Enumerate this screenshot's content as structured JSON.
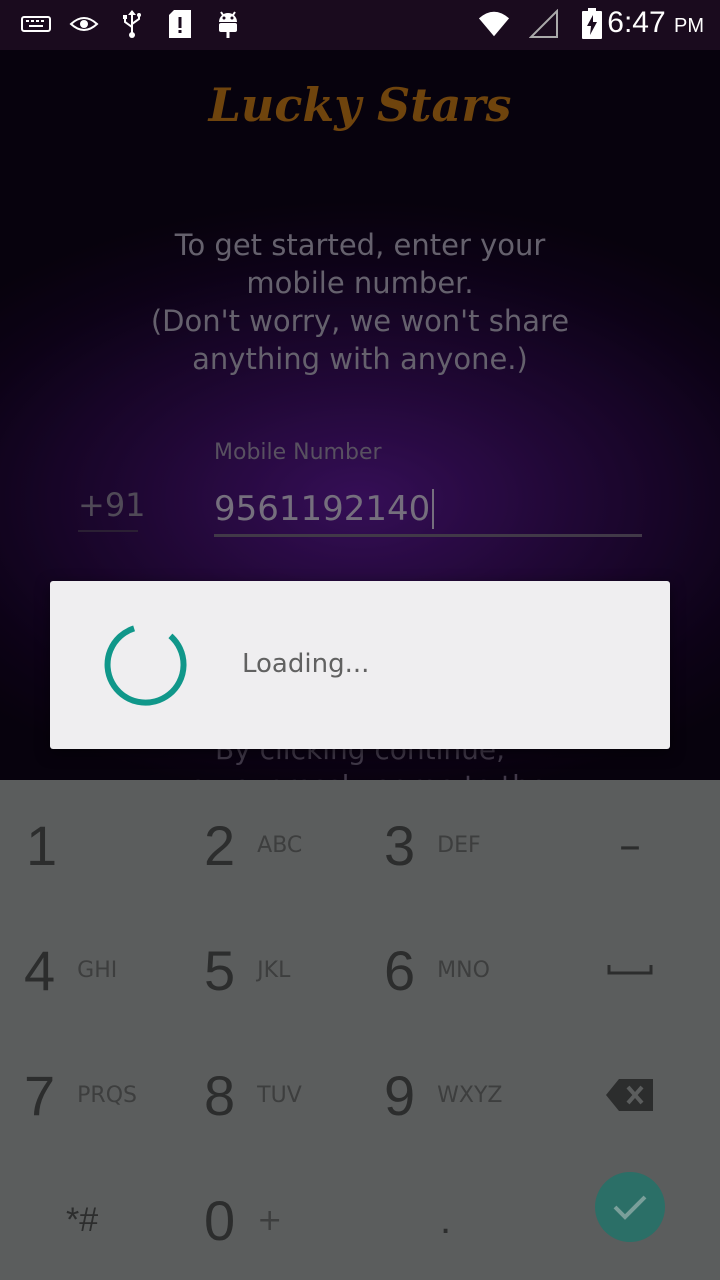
{
  "status_bar": {
    "time": "6:47",
    "ampm": "PM",
    "icons": [
      "keyboard-icon",
      "eye-icon",
      "usb-icon",
      "sd-card-alert-icon",
      "android-debug-icon",
      "wifi-icon",
      "cellular-signal-icon",
      "battery-charging-icon"
    ]
  },
  "app": {
    "brand": "Lucky Stars",
    "intro_lines": [
      "To get started, enter your",
      "mobile number.",
      "(Don't worry, we won't share",
      "anything with anyone.)"
    ],
    "country_code": "+91",
    "field_label": "Mobile Number",
    "phone_value": "9561192140",
    "terms_lines": [
      "By clicking continue,",
      "you expressly agree to the"
    ]
  },
  "dialog": {
    "loading_text": "Loading...",
    "accent": "#10978a"
  },
  "keypad": {
    "keys": [
      {
        "num": "1",
        "letters": ""
      },
      {
        "num": "2",
        "letters": "ABC"
      },
      {
        "num": "3",
        "letters": "DEF"
      },
      {
        "num": "4",
        "letters": "GHI"
      },
      {
        "num": "5",
        "letters": "JKL"
      },
      {
        "num": "6",
        "letters": "MNO"
      },
      {
        "num": "7",
        "letters": "PRQS"
      },
      {
        "num": "8",
        "letters": "TUV"
      },
      {
        "num": "9",
        "letters": "WXYZ"
      },
      {
        "num": "*#",
        "letters": ""
      },
      {
        "num": "0",
        "letters": "+"
      },
      {
        "num": ".",
        "letters": ""
      }
    ],
    "minus_label": "–",
    "accent": "#2b6f67"
  }
}
